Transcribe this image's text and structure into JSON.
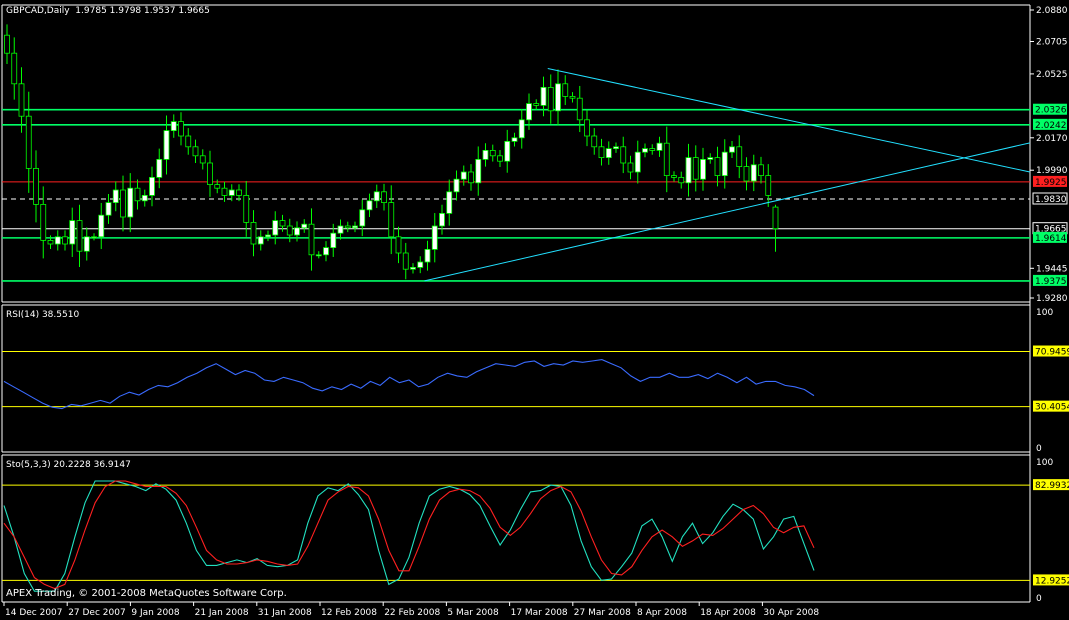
{
  "window": {
    "symbol_header": "GBPCAD,Daily  1.9785 1.9798 1.9537 1.9665",
    "copyright": "APEX Trading, © 2001-2008 MetaQuotes Software Corp."
  },
  "colors": {
    "background": "#000000",
    "frame": "#ffffff",
    "bull_candle": "#ffffff",
    "bear_candle": "#000000",
    "candle_wick": "#00ff00",
    "support_line": "#00ff66",
    "resistance_red": "#ff2020",
    "trend_line": "#22e0ff",
    "rsi_line": "#3a6bff",
    "sto_main": "#22e0c0",
    "sto_signal": "#ff2020",
    "level_yellow": "#ffff00"
  },
  "chart_data": [
    {
      "type": "candlestick",
      "name": "price",
      "title": "GBPCAD,Daily",
      "ylim": [
        1.928,
        2.088
      ],
      "y_ticks": [
        "2.0880",
        "2.0705",
        "2.0525",
        "2.0170",
        "1.9990",
        "1.9445",
        "1.9280"
      ],
      "x_tick_labels": [
        "14 Dec 2007",
        "27 Dec 2007",
        "9 Jan 2008",
        "21 Jan 2008",
        "31 Jan 2008",
        "12 Feb 2008",
        "22 Feb 2008",
        "5 Mar 2008",
        "17 Mar 2008",
        "27 Mar 2008",
        "8 Apr 2008",
        "18 Apr 2008",
        "30 Apr 2008"
      ],
      "last_ohlc": {
        "open": 1.9785,
        "high": 1.9798,
        "low": 1.9537,
        "close": 1.9665
      },
      "closes": [
        2.064,
        2.047,
        2.029,
        2.0,
        1.98,
        1.96,
        1.958,
        1.962,
        1.958,
        1.971,
        1.954,
        1.962,
        1.962,
        1.974,
        1.981,
        1.988,
        1.973,
        1.989,
        1.982,
        1.985,
        1.995,
        2.005,
        2.021,
        2.026,
        2.018,
        2.012,
        2.007,
        2.003,
        1.991,
        1.989,
        1.985,
        1.988,
        1.985,
        1.97,
        1.958,
        1.962,
        1.963,
        1.971,
        1.968,
        1.963,
        1.967,
        1.969,
        1.952,
        1.952,
        1.956,
        1.964,
        1.968,
        1.967,
        1.968,
        1.977,
        1.982,
        1.987,
        1.981,
        1.962,
        1.953,
        1.944,
        1.945,
        1.948,
        1.955,
        1.968,
        1.975,
        1.987,
        1.994,
        1.998,
        1.992,
        2.005,
        2.01,
        2.007,
        2.004,
        2.015,
        2.017,
        2.027,
        2.036,
        2.035,
        2.045,
        2.032,
        2.047,
        2.04,
        2.039,
        2.027,
        2.018,
        2.012,
        2.006,
        2.011,
        2.012,
        2.003,
        1.998,
        2.009,
        2.011,
        2.01,
        2.014,
        1.996,
        1.995,
        1.992,
        2.006,
        1.994,
        2.005,
        2.006,
        1.996,
        2.009,
        2.012,
        2.001,
        1.993,
        2.002,
        1.996,
        1.985,
        1.9665
      ],
      "horizontal_levels": [
        {
          "price": 2.0326,
          "label": "2.0326",
          "color": "#00ff66"
        },
        {
          "price": 2.0242,
          "label": "2.0242",
          "color": "#00ff66"
        },
        {
          "price": 1.9925,
          "label": "1.9925",
          "color": "#ff2020"
        },
        {
          "price": 1.983,
          "label": "1.9830",
          "color": "#ffffff"
        },
        {
          "price": 1.9665,
          "label": "1.9665",
          "color": "#ffffff"
        },
        {
          "price": 1.9614,
          "label": "1.9614",
          "color": "#00ff66"
        },
        {
          "price": 1.9375,
          "label": "1.9375",
          "color": "#00ff66"
        }
      ],
      "trend_lines": [
        {
          "from": {
            "bar": 75,
            "price": 2.0555
          },
          "to": {
            "bar": 180,
            "price": 1.998
          }
        },
        {
          "from": {
            "bar": 58,
            "price": 1.9375
          },
          "to": {
            "bar": 180,
            "price": 2.0142
          }
        }
      ]
    },
    {
      "type": "line",
      "name": "rsi",
      "title": "RSI(14) 38.5510",
      "ylim": [
        0,
        100
      ],
      "y_ticks": [
        "100",
        "0"
      ],
      "levels": [
        {
          "value": 70.9459,
          "label": "70.9459"
        },
        {
          "value": 30.4054,
          "label": "30.4054"
        }
      ],
      "values": [
        49,
        45,
        41,
        37,
        33,
        30,
        29,
        32,
        31,
        33,
        35,
        33,
        38,
        41,
        39,
        43,
        46,
        45,
        48,
        52,
        55,
        59,
        62,
        58,
        54,
        57,
        55,
        50,
        49,
        52,
        50,
        48,
        44,
        42,
        45,
        43,
        47,
        44,
        49,
        46,
        52,
        48,
        50,
        45,
        47,
        52,
        55,
        53,
        52,
        56,
        59,
        62,
        61,
        60,
        63,
        64,
        60,
        62,
        61,
        64,
        63,
        64,
        65,
        62,
        59,
        53,
        49,
        52,
        52,
        55,
        52,
        52,
        54,
        51,
        55,
        52,
        48,
        52,
        47,
        49,
        49,
        46,
        45,
        43,
        38.551
      ]
    },
    {
      "type": "line",
      "name": "stochastic",
      "title": "Sto(5,3,3) 20.2228 36.9147",
      "ylim": [
        0,
        100
      ],
      "y_ticks": [
        "100",
        "0"
      ],
      "levels": [
        {
          "value": 82.9932,
          "label": "82.9932"
        },
        {
          "value": 12.9252,
          "label": "12.9252"
        }
      ],
      "series": [
        {
          "name": "main",
          "values": [
            68,
            45,
            18,
            5,
            5,
            5,
            18,
            45,
            70,
            86,
            86,
            86,
            84,
            82,
            79,
            84,
            80,
            72,
            55,
            35,
            24,
            24,
            26,
            28,
            26,
            29,
            24,
            23,
            24,
            28,
            55,
            75,
            81,
            79,
            84,
            76,
            65,
            35,
            10,
            14,
            30,
            55,
            75,
            80,
            82,
            80,
            76,
            68,
            53,
            39,
            50,
            65,
            78,
            79,
            83,
            82,
            68,
            42,
            23,
            13,
            14,
            23,
            33,
            53,
            58,
            45,
            27,
            45,
            55,
            40,
            48,
            60,
            69,
            65,
            58,
            36,
            45,
            58,
            60,
            40,
            20.2228
          ]
        },
        {
          "name": "signal",
          "values": [
            55,
            45,
            30,
            15,
            10,
            7,
            10,
            28,
            50,
            70,
            82,
            86,
            86,
            84,
            82,
            82,
            82,
            77,
            68,
            52,
            35,
            28,
            25,
            25,
            26,
            28,
            27,
            25,
            24,
            25,
            38,
            55,
            72,
            78,
            82,
            81,
            75,
            58,
            35,
            20,
            20,
            38,
            58,
            72,
            78,
            80,
            79,
            75,
            66,
            52,
            46,
            52,
            62,
            73,
            79,
            82,
            78,
            64,
            45,
            28,
            18,
            17,
            23,
            35,
            45,
            50,
            45,
            38,
            42,
            47,
            46,
            51,
            58,
            65,
            68,
            62,
            52,
            48,
            52,
            53,
            36.9147
          ]
        }
      ]
    }
  ]
}
